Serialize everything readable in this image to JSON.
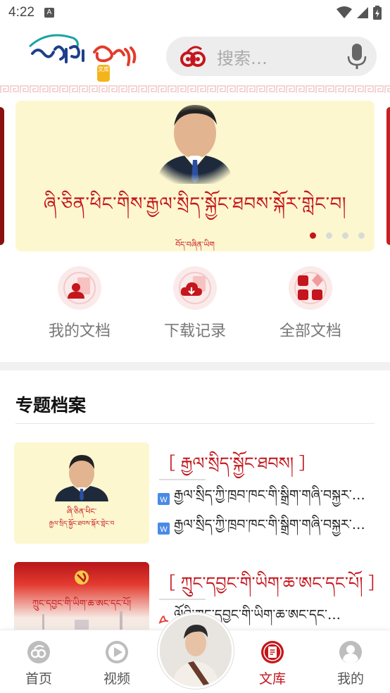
{
  "status_bar": {
    "time": "4:22",
    "notif_letter": "A"
  },
  "header": {
    "logo_text": "ཡིག་ཚང་",
    "logo_badge": "文库",
    "search_placeholder": "搜索…"
  },
  "banner": {
    "title": "ཞི་ཅིན་ཕིང་གིས་རྒྱལ་སྲིད་སྐྱོང་ཐབས་སྐོར་གླེང་བ།",
    "subtitle": "བོད་བཞིན་ཡིག",
    "dots_total": 4,
    "dots_active": 0
  },
  "quick_actions": [
    {
      "label": "我的文档",
      "icon": "user-document-icon"
    },
    {
      "label": "下载记录",
      "icon": "download-icon"
    },
    {
      "label": "全部文档",
      "icon": "grid-icon"
    }
  ],
  "topics_section": {
    "title": "专题档案"
  },
  "topics": [
    {
      "title": "［ རྒྱལ་སྲིད་སྐྱོང་ཐབས། ］",
      "thumb_caption_1": "ཞི་ཅིན་ཕིང་",
      "thumb_caption_2": "རྒྱལ་སྲིད་སྐྱོང་ཐབས་སྐོར་གླེང་བ",
      "docs": [
        {
          "type": "word",
          "text": "རྒྱལ་སྲིད་ཀྱི་ཁྲབ་ཁང་གི་སྒྲིག་གཞི་བསྐྱར་…"
        },
        {
          "type": "word",
          "text": "རྒྱལ་སྲིད་ཀྱི་ཁྲབ་ཁང་གི་སྒྲིག་གཞི་བསྐྱར་…"
        }
      ]
    },
    {
      "title": "［ ཀྲུང་དབྱང་གི་ཡིག་ཆ་ཨང་དང་པོ། ］",
      "thumb_caption_1": "ཀྲུང་དབྱང་གི་ཡིག་ཆ་ཨང་དང་པོ།",
      "docs": [
        {
          "type": "pdf",
          "text": "ལོའི་ཀྲུང་དབྱང་གི་ཡིག་ཆ་ཨང་དང་…"
        }
      ]
    }
  ],
  "bottom_nav": [
    {
      "label": "首页",
      "icon": "home-logo-icon",
      "active": false
    },
    {
      "label": "视频",
      "icon": "play-icon",
      "active": false
    },
    {
      "label": "文库",
      "icon": "library-icon",
      "active": true
    },
    {
      "label": "我的",
      "icon": "user-icon",
      "active": false
    }
  ],
  "colors": {
    "accent": "#c4161c",
    "banner_bg": "#fdf7cf",
    "search_bg": "#ededed"
  }
}
